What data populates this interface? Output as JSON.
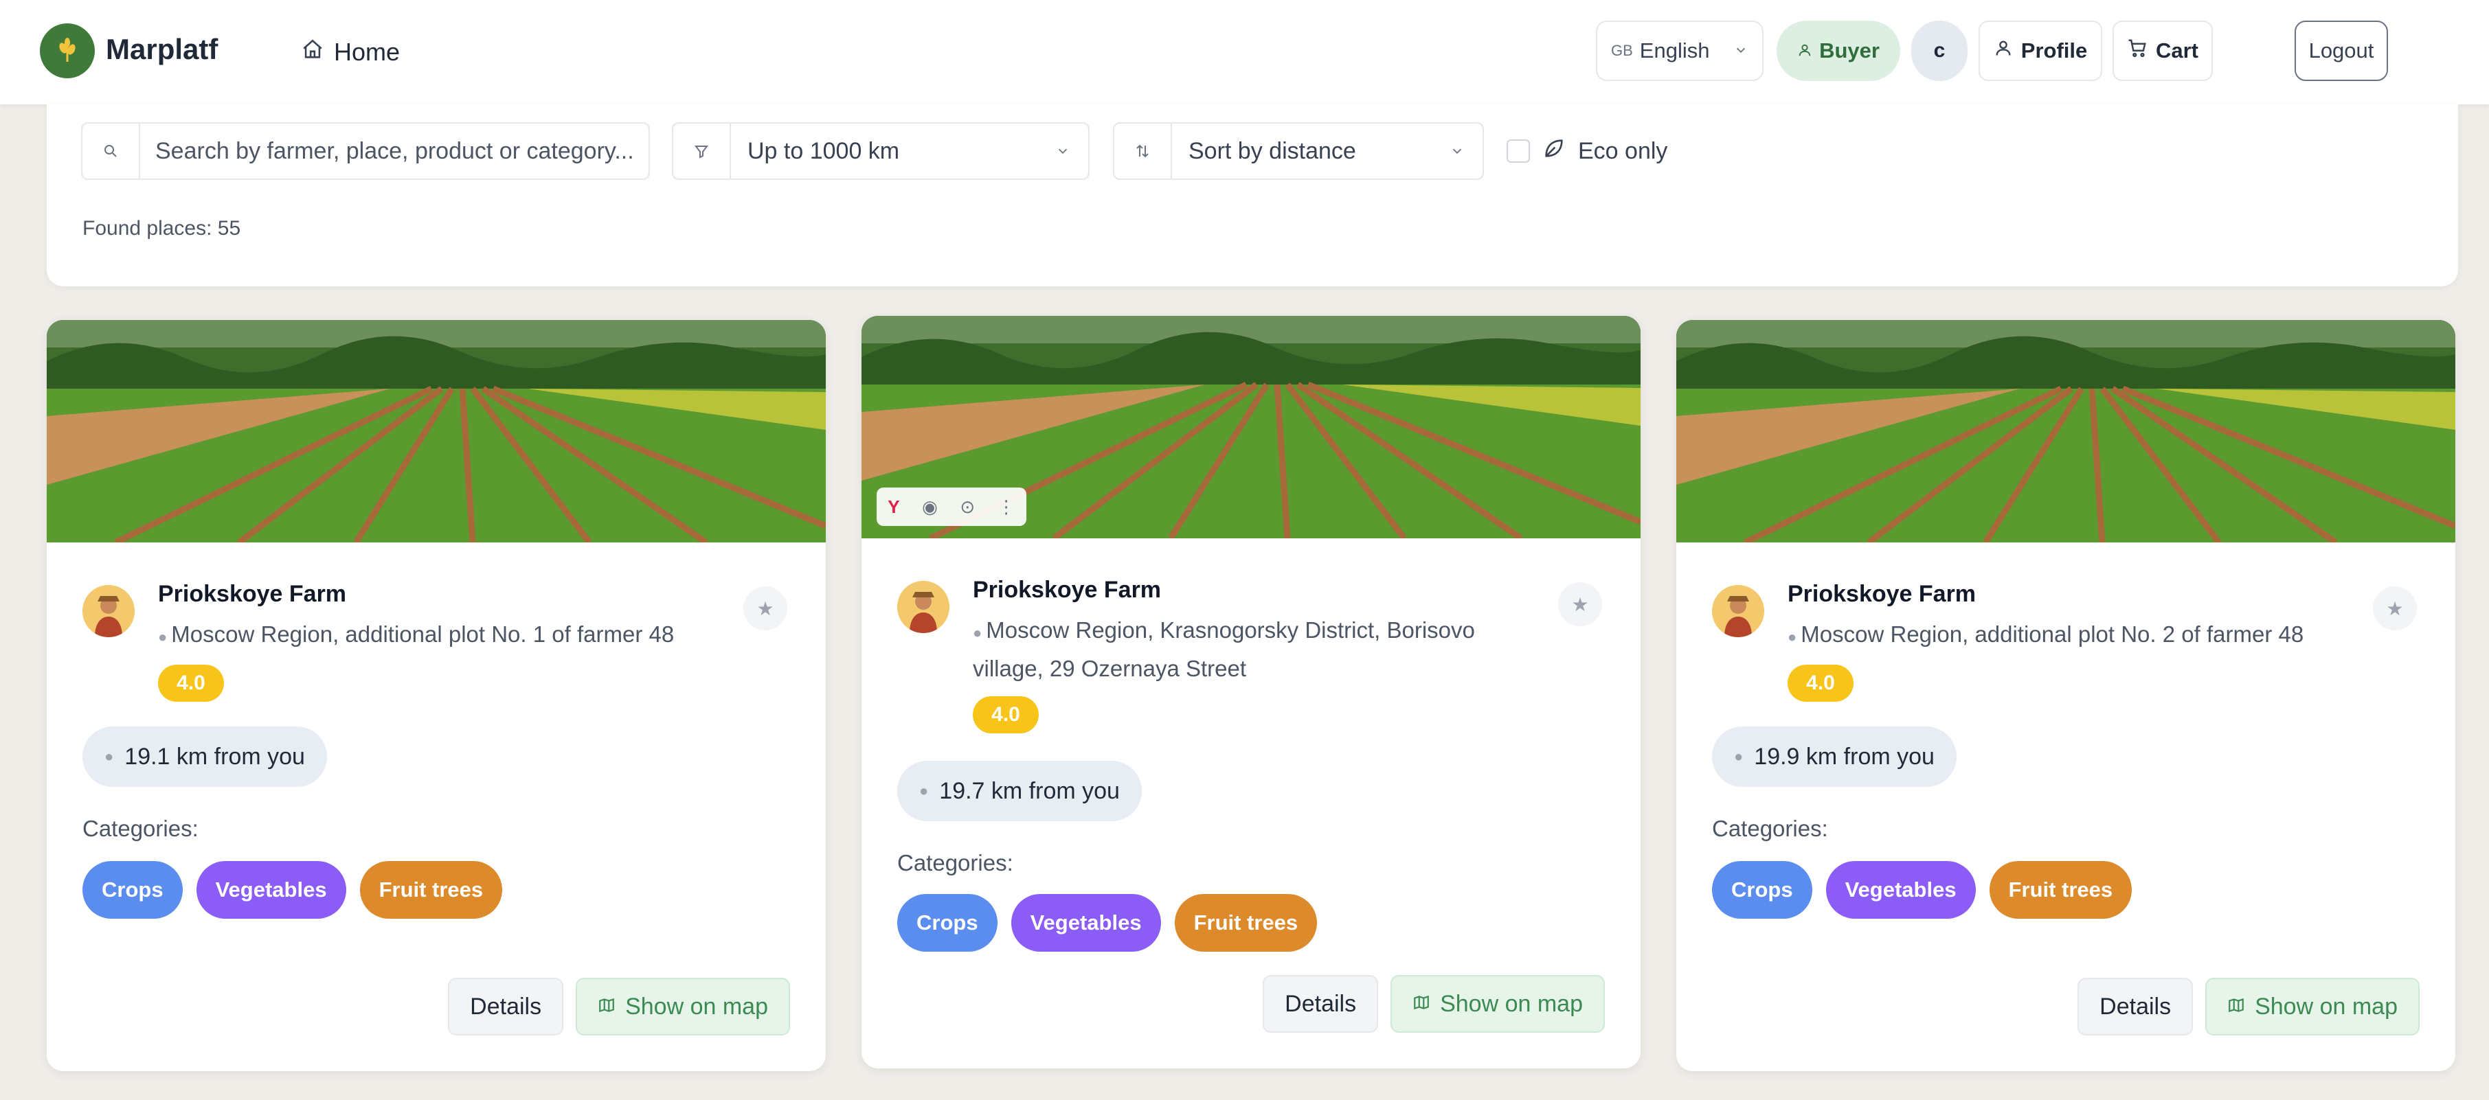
{
  "header": {
    "brand": "Marplatf",
    "nav_home": "Home",
    "language": "English",
    "language_flag": "GB",
    "role": "Buyer",
    "avatar_initial": "c",
    "profile": "Profile",
    "cart": "Cart",
    "logout": "Logout"
  },
  "filters": {
    "search_placeholder": "Search by farmer, place, product or category...",
    "radius": "Up to 1000 km",
    "sort": "Sort by distance",
    "eco_label": "Eco only",
    "eco_checked": false,
    "found": "Found places: 55"
  },
  "colors": {
    "brand_green": "#3f7a3a",
    "rating": "#f8c41a",
    "chip_crops": "#5b8def",
    "chip_vegetables": "#8b5cf6",
    "chip_fruit": "#dd8a2b"
  },
  "cards": [
    {
      "name": "Priokskoye Farm",
      "address": "Moscow Region, additional plot No. 1 of farmer 48",
      "rating": "4.0",
      "distance": "19.1 km from you",
      "categories_label": "Categories:",
      "categories": [
        "Crops",
        "Vegetables",
        "Fruit trees"
      ],
      "details": "Details",
      "show_on_map": "Show on map"
    },
    {
      "name": "Priokskoye Farm",
      "address": "Moscow Region, Krasnogorsky District, Borisovo village, 29 Ozernaya Street",
      "rating": "4.0",
      "distance": "19.7 km from you",
      "categories_label": "Categories:",
      "categories": [
        "Crops",
        "Vegetables",
        "Fruit trees"
      ],
      "details": "Details",
      "show_on_map": "Show on map"
    },
    {
      "name": "Priokskoye Farm",
      "address": "Moscow Region, additional plot No. 2 of farmer 48",
      "rating": "4.0",
      "distance": "19.9 km from you",
      "categories_label": "Categories:",
      "categories": [
        "Crops",
        "Vegetables",
        "Fruit trees"
      ],
      "details": "Details",
      "show_on_map": "Show on map"
    }
  ]
}
